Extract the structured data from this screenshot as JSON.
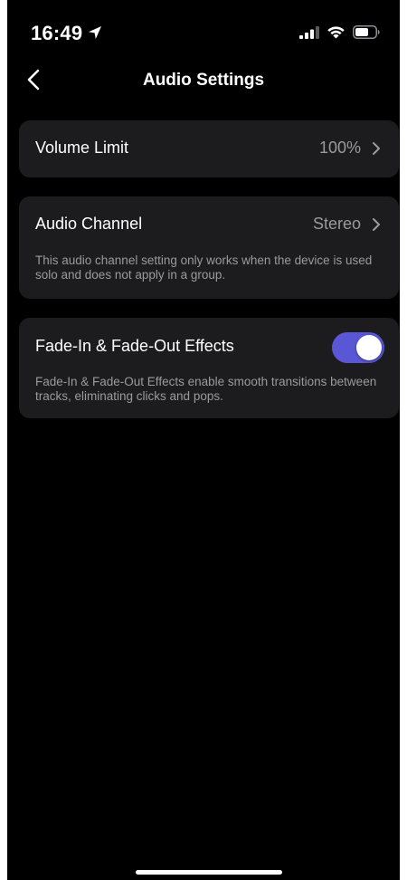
{
  "status_bar": {
    "time": "16:49",
    "location_icon": "location-arrow-icon",
    "signal_icon": "cellular-signal-icon",
    "wifi_icon": "wifi-icon",
    "battery_icon": "battery-icon"
  },
  "nav": {
    "back_icon": "chevron-left-icon",
    "title": "Audio Settings"
  },
  "settings": {
    "volume_limit": {
      "label": "Volume Limit",
      "value": "100%"
    },
    "audio_channel": {
      "label": "Audio Channel",
      "value": "Stereo",
      "description": "This audio channel setting only works when the device is used solo and does not apply in a group."
    },
    "fade_effects": {
      "label": "Fade-In & Fade-Out Effects",
      "enabled": true,
      "description": "Fade-In & Fade-Out Effects enable smooth transitions between tracks, eliminating clicks and pops."
    }
  },
  "colors": {
    "background": "#000000",
    "card": "#1c1c1e",
    "secondary_text": "#9a9a9f",
    "toggle_on": "#5a57d6"
  }
}
